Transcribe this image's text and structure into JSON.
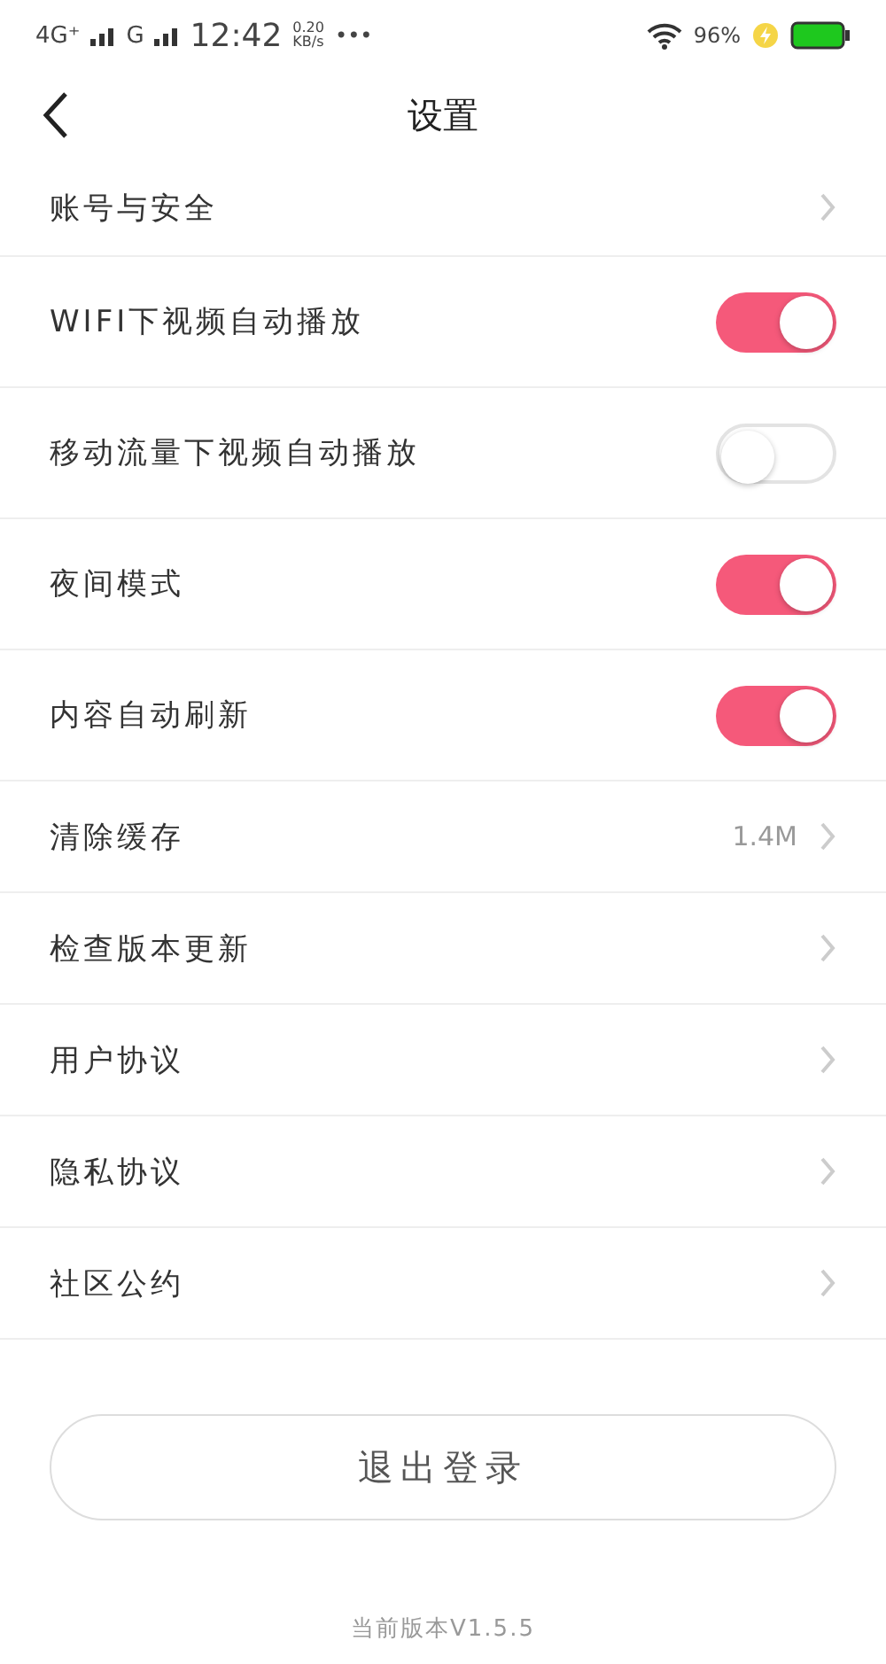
{
  "status_bar": {
    "network": "4G⁺",
    "network_2": "G",
    "time": "12:42",
    "speed": "0.20",
    "speed_unit": "KB/s",
    "more": "•••",
    "battery": "96%"
  },
  "nav": {
    "title": "设置"
  },
  "items": [
    {
      "kind": "link",
      "label": "账号与安全"
    },
    {
      "kind": "toggle",
      "label": "WIFI下视频自动播放",
      "on": true
    },
    {
      "kind": "toggle",
      "label": "移动流量下视频自动播放",
      "on": false
    },
    {
      "kind": "toggle",
      "label": "夜间模式",
      "on": true
    },
    {
      "kind": "toggle",
      "label": "内容自动刷新",
      "on": true
    },
    {
      "kind": "link",
      "label": "清除缓存",
      "value": "1.4M"
    },
    {
      "kind": "link",
      "label": "检查版本更新"
    },
    {
      "kind": "link",
      "label": "用户协议"
    },
    {
      "kind": "link",
      "label": "隐私协议"
    },
    {
      "kind": "link",
      "label": "社区公约"
    }
  ],
  "logout_button": "退出登录",
  "version": "当前版本V1.5.5"
}
